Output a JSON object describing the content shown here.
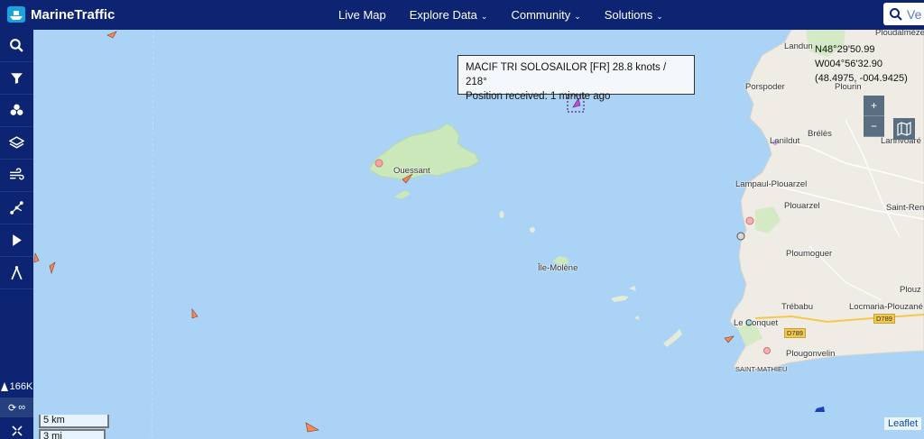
{
  "brand": {
    "name": "MarineTraffic"
  },
  "nav": {
    "items": [
      "Live Map",
      "Explore Data",
      "Community",
      "Solutions"
    ]
  },
  "search": {
    "placeholder": "Ve"
  },
  "sidebar": {
    "buttons": [
      "search-icon",
      "filter-icon",
      "fleet-icon",
      "layers-icon",
      "weather-icon",
      "tools-icon",
      "playback-icon",
      "measure-icon"
    ],
    "vessel_count": "166K",
    "infinity_label": "∞"
  },
  "popup": {
    "line1": "MACIF TRI SOLOSAILOR [FR] 28.8 knots / 218°",
    "line2": "Position received: 1 minute ago"
  },
  "coords": {
    "lat": "N48°29'50.99",
    "lon": "W004°56'32.90",
    "decimal": "(48.4975, -004.9425)"
  },
  "zoom": {
    "in": "+",
    "out": "−"
  },
  "scale": {
    "km": "5 km",
    "mi": "3 mi"
  },
  "attribution": "Leaflet",
  "places": {
    "ouessant": "Ouessant",
    "ile_molene": "Île-Molène",
    "landunvez": "Landun",
    "porspoder": "Porspoder",
    "ploudalmezeau": "Ploudalmézeau",
    "plourin": "Plourin",
    "lanildut": "Lanildut",
    "lanrivoare": "Lanrivoaré",
    "breles": "Brélès",
    "lampaul": "Lampaul-Plouarzel",
    "plouarzel": "Plouarzel",
    "saint_renan": "Saint-Ren",
    "ploumoguer": "Ploumoguer",
    "trebabu": "Trébabu",
    "le_conquet": "Le Conquet",
    "locmaria": "Locmaria-Plouzané",
    "plouz": "Plouz",
    "plougonvelin": "Plougonvelin",
    "saint_mathieu": "SAINT-MATHIEU",
    "road1": "D789",
    "road2": "D789"
  }
}
